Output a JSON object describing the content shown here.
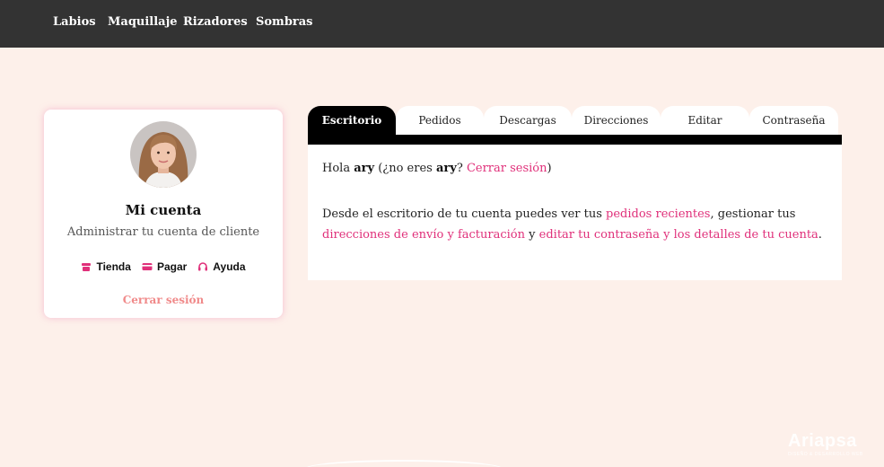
{
  "nav": {
    "items": [
      {
        "label": "Labios"
      },
      {
        "label": "Maquillaje"
      },
      {
        "label": "Rizadores"
      },
      {
        "label": "Sombras"
      }
    ]
  },
  "profile": {
    "title": "Mi cuenta",
    "subtitle": "Administrar tu cuenta de cliente",
    "links": [
      {
        "label": "Tienda",
        "icon": "store-icon"
      },
      {
        "label": "Pagar",
        "icon": "credit-card-icon"
      },
      {
        "label": "Ayuda",
        "icon": "headphones-icon"
      }
    ],
    "logout": "Cerrar sesión"
  },
  "tabs": [
    {
      "label": "Escritorio",
      "active": true
    },
    {
      "label": "Pedidos"
    },
    {
      "label": "Descargas"
    },
    {
      "label": "Direcciones"
    },
    {
      "label": "Editar"
    },
    {
      "label": "Contraseña"
    }
  ],
  "dashboard": {
    "greeting_hola": "Hola",
    "username": "ary",
    "greeting_no_eres": "(¿no eres",
    "username2": "ary",
    "qmark": "?",
    "logout_link": "Cerrar sesión",
    "close_paren": ")",
    "desc_1": "Desde el escritorio de tu cuenta puedes ver tus",
    "link_orders": "pedidos recientes",
    "desc_2": ", gestionar tus",
    "link_addresses": "direcciones de envío y facturación",
    "desc_3": "y",
    "link_edit": "editar tu contraseña y los detalles de tu cuenta",
    "desc_4": "."
  },
  "watermark": {
    "brand": "Ariapsa",
    "tagline": "DISEÑO & DESARROLLO WEB"
  },
  "colors": {
    "accent": "#e0307a",
    "logout_card": "#f08a8a",
    "topbar": "#333333",
    "background": "#fdf0ea"
  }
}
